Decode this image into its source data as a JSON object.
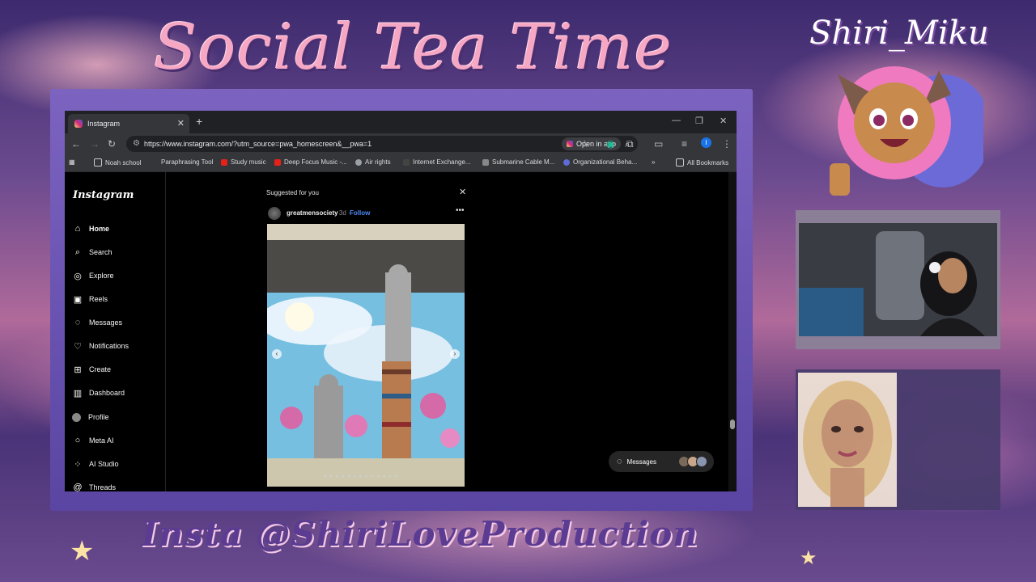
{
  "overlay": {
    "title": "Social Tea Time",
    "streamer_name": "Shiri_Miku",
    "insta_handle": "Insta @ShiriLoveProduction"
  },
  "browser": {
    "tab_title": "Instagram",
    "url": "https://www.instagram.com/?utm_source=pwa_homescreen&__pwa=1",
    "open_in_app": "Open in app",
    "profile_initial": "I",
    "bookmarks": [
      "Noah school",
      "Paraphrasing Tool",
      "Study music",
      "Deep Focus Music -...",
      "Air rights",
      "Internet Exchange...",
      "Submarine Cable M...",
      "Organizational Beha...",
      "All Bookmarks"
    ]
  },
  "instagram": {
    "logo": "Instagram",
    "nav": [
      {
        "label": "Home",
        "icon": "home-icon"
      },
      {
        "label": "Search",
        "icon": "search-icon"
      },
      {
        "label": "Explore",
        "icon": "compass-icon"
      },
      {
        "label": "Reels",
        "icon": "reels-icon"
      },
      {
        "label": "Messages",
        "icon": "messenger-icon"
      },
      {
        "label": "Notifications",
        "icon": "heart-icon"
      },
      {
        "label": "Create",
        "icon": "plus-icon"
      },
      {
        "label": "Dashboard",
        "icon": "dashboard-icon"
      },
      {
        "label": "Profile",
        "icon": "avatar-icon"
      },
      {
        "label": "Meta AI",
        "icon": "meta-ai-icon"
      },
      {
        "label": "AI Studio",
        "icon": "ai-studio-icon"
      },
      {
        "label": "Threads",
        "icon": "threads-icon"
      }
    ],
    "feed": {
      "header": "Suggested for you",
      "post_user": "greatmensociety",
      "post_time": "· 3d ·",
      "follow_label": "Follow"
    },
    "messages_pill": "Messages"
  },
  "colors": {
    "accent_pink": "#f6a7c4",
    "frame_purple": "#6e55b3",
    "instagram_blue": "#4c8bf5"
  }
}
